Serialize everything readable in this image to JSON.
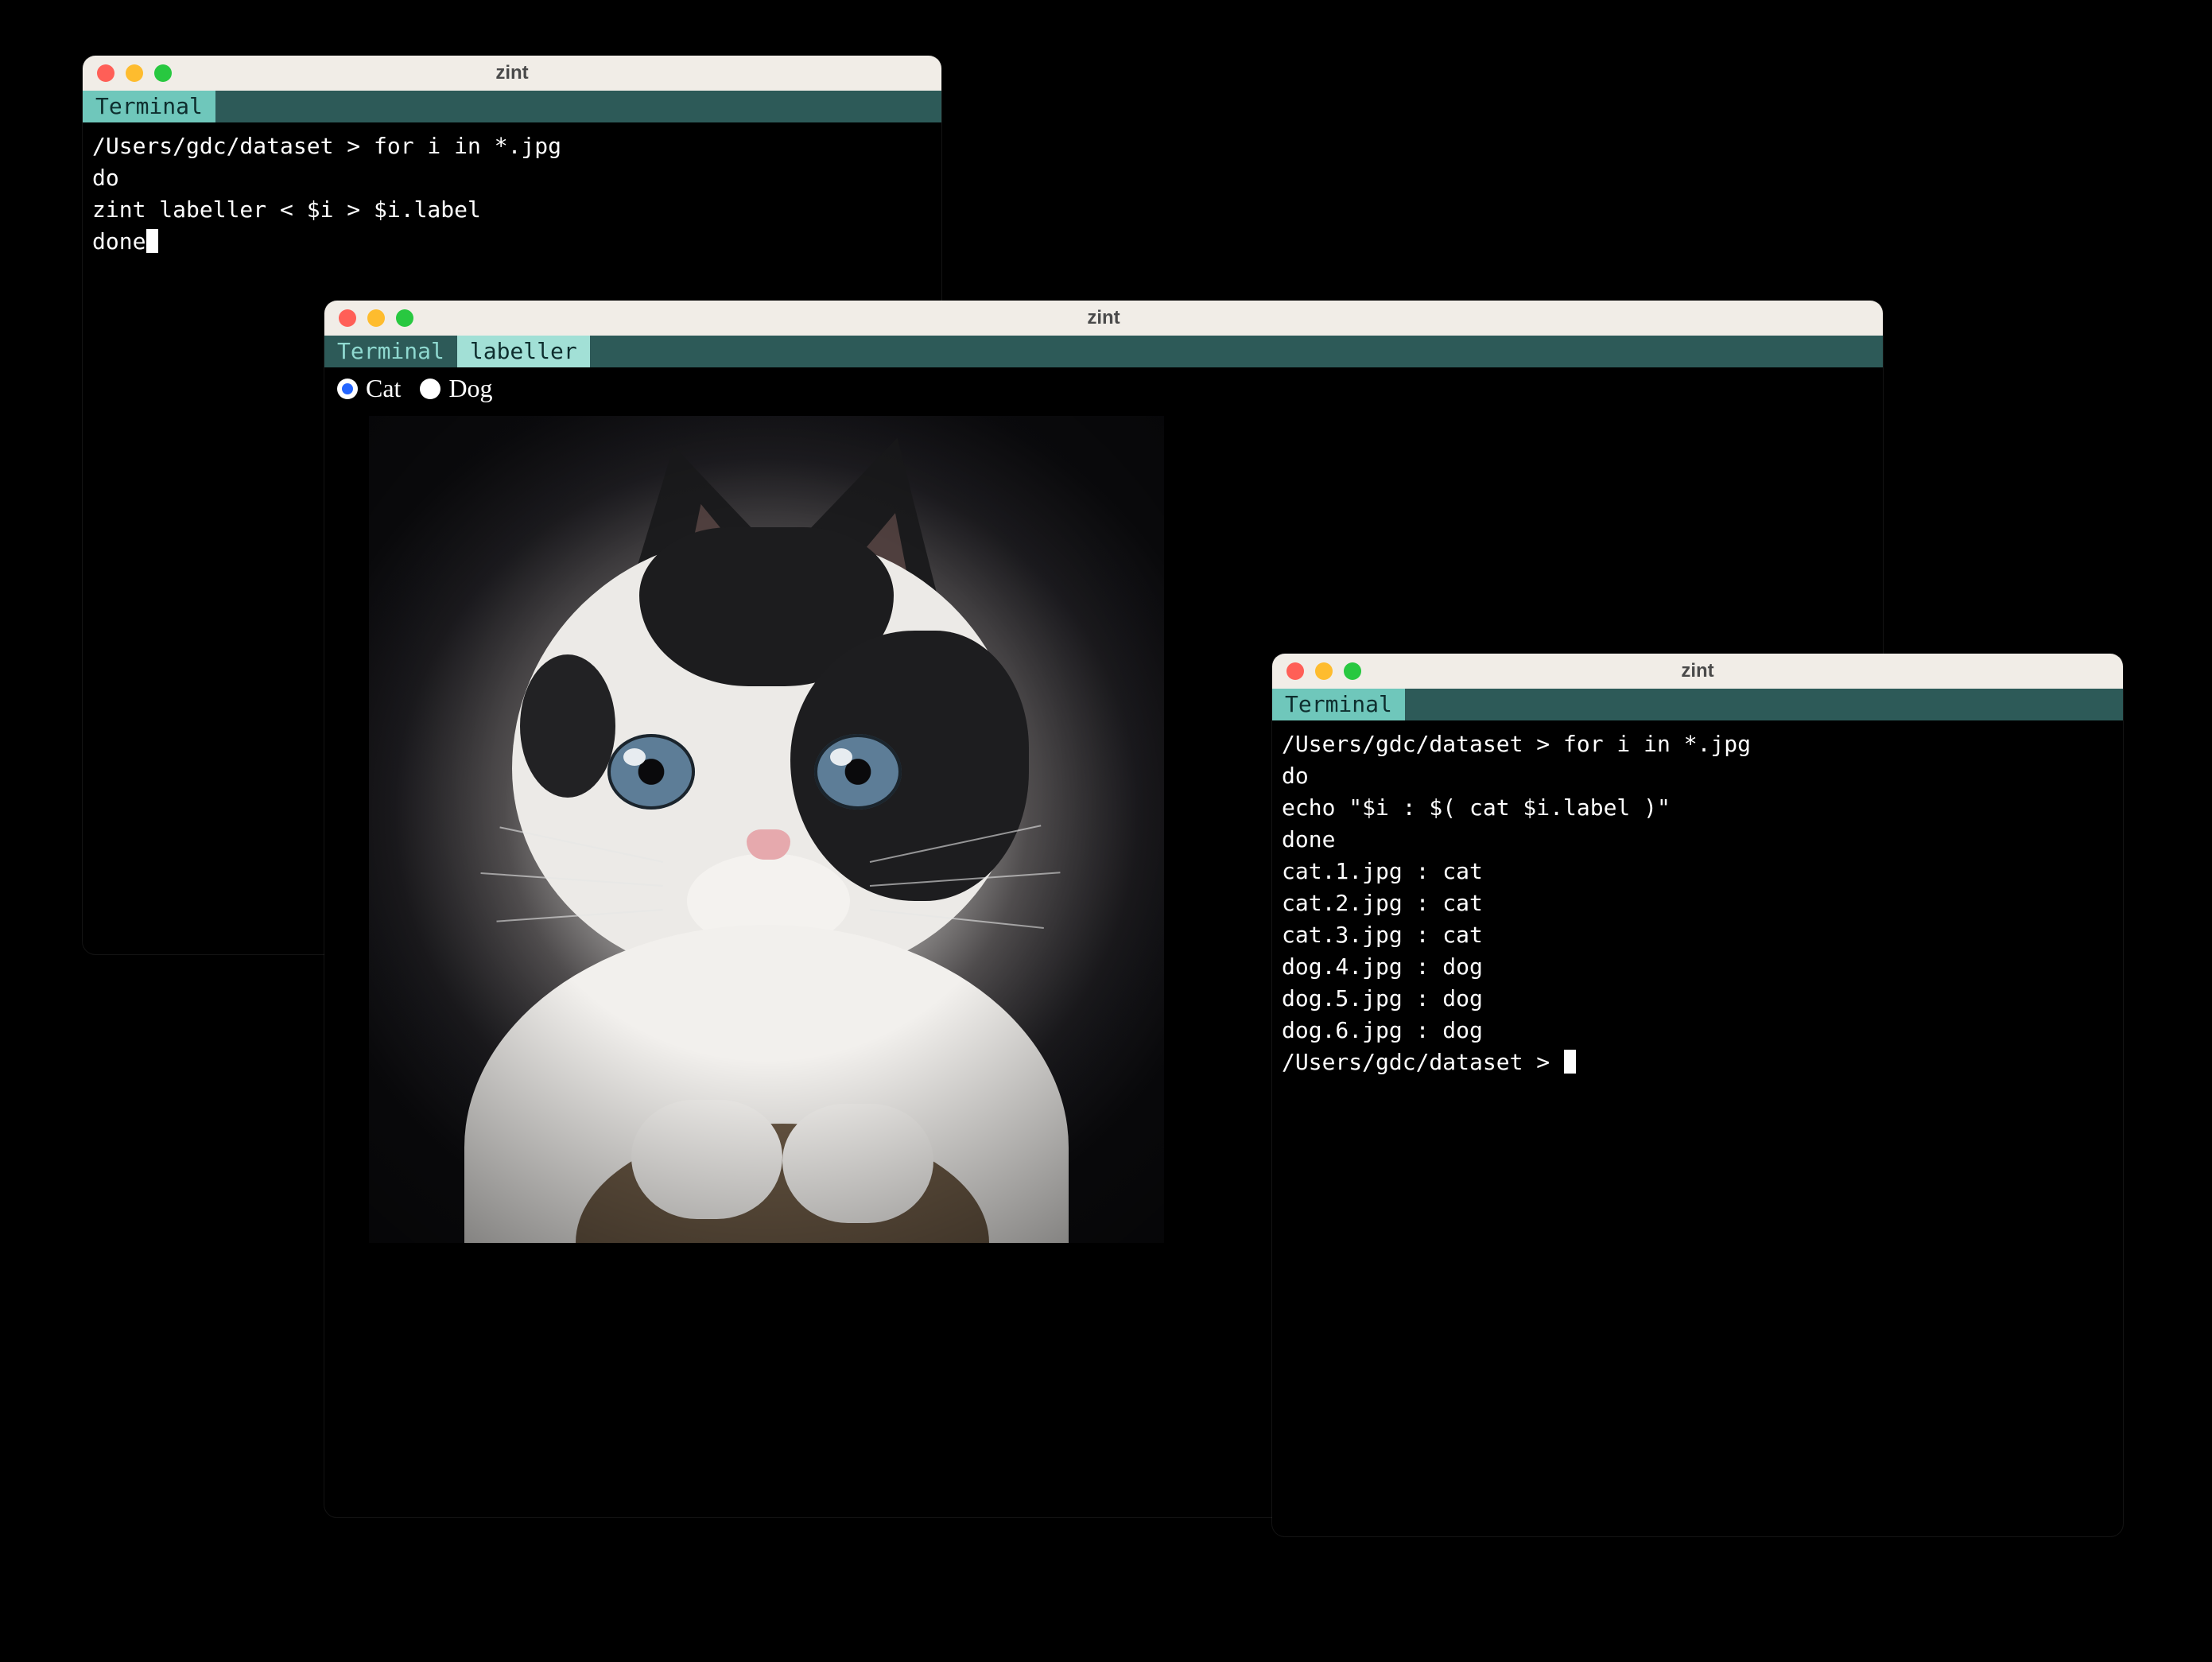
{
  "app_title": "zint",
  "window1": {
    "tabs": [
      {
        "label": "Terminal",
        "active": true
      }
    ],
    "lines": [
      "/Users/gdc/dataset > for i in *.jpg",
      "do",
      "zint labeller < $i > $i.label",
      "done"
    ],
    "cursor_after_last": true
  },
  "window2": {
    "tabs": [
      {
        "label": "Terminal",
        "active": false
      },
      {
        "label": "labeller",
        "active": true
      }
    ],
    "labeller": {
      "options": [
        {
          "label": "Cat",
          "checked": true
        },
        {
          "label": "Dog",
          "checked": false
        }
      ],
      "image_subject": "black-and-white kitten"
    }
  },
  "window3": {
    "tabs": [
      {
        "label": "Terminal",
        "active": true
      }
    ],
    "lines": [
      "/Users/gdc/dataset > for i in *.jpg",
      "do",
      "echo \"$i : $( cat $i.label )\"",
      "done",
      "cat.1.jpg : cat",
      "cat.2.jpg : cat",
      "cat.3.jpg : cat",
      "dog.4.jpg : dog",
      "dog.5.jpg : dog",
      "dog.6.jpg : dog",
      "/Users/gdc/dataset > "
    ],
    "cursor_after_last": true
  }
}
